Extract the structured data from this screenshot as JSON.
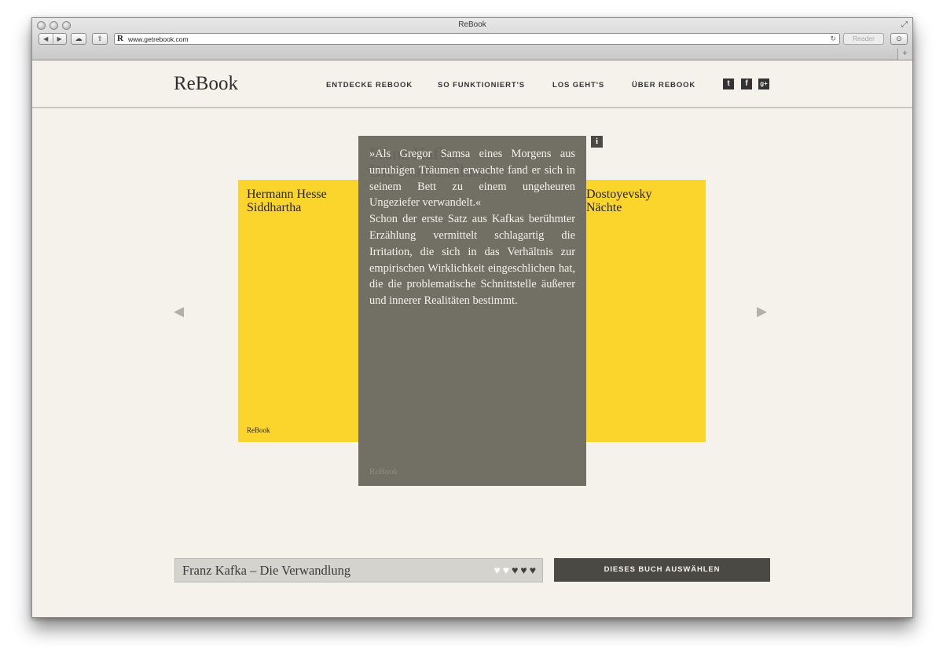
{
  "browser": {
    "window_title": "ReBook",
    "favicon": "R",
    "url": "www.getrebook.com",
    "reader_label": "Reader",
    "icons": [
      "back-arrow-icon",
      "forward-arrow-icon",
      "icloud-icon",
      "share-icon",
      "reload-icon",
      "download-icon",
      "fullscreen-icon",
      "plus-icon"
    ]
  },
  "site": {
    "logo": "ReBook",
    "nav": [
      "ENTDECKE REBOOK",
      "SO FUNKTIONIERT'S",
      "LOS GEHT'S",
      "ÜBER REBOOK"
    ],
    "social_icons": [
      "twitter-icon",
      "facebook-icon",
      "google-plus-icon"
    ]
  },
  "carousel": {
    "left_book": {
      "author": "Hermann Hesse",
      "title": "Siddhartha",
      "brand": "ReBook",
      "color": "#fbd52c"
    },
    "right_book": {
      "author": "Dostoyevsky",
      "title": "Nächte",
      "color": "#fbd52c"
    },
    "main_book": {
      "ghost_author": "Franz Kafka",
      "ghost_title": "Die Verwandlung",
      "quote": "»Als Gregor Samsa eines Morgens aus unruhigen Träumen erwachte fand er sich in seinem Bett zu einem ungeheuren Ungeziefer verwandelt.«",
      "description": "Schon der erste Satz aus Kafkas berühmter Erzählung vermittelt schlagartig die Irritation, die sich in das Verhältnis zur empirischen Wirklichkeit eingeschlichen hat, die die problematische Schnittstelle äußerer und innerer Realitäten bestimmt.",
      "brand": "ReBook",
      "color": "#727065"
    },
    "info_label": "i"
  },
  "selection": {
    "current_title": "Franz Kafka – Die Verwandlung",
    "rating": {
      "value": 3,
      "max": 5
    },
    "button_label": "DIESES BUCH AUSWÄHLEN"
  }
}
